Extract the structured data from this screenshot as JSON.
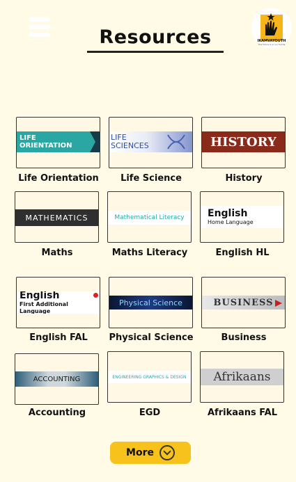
{
  "header": {
    "title": "Resources",
    "logo": {
      "name": "IKAMVAYOUTH",
      "tagline": "The future is in our hands"
    }
  },
  "resources": [
    {
      "label": "Life Orientation",
      "banner": "LIFE\nORIENTATION"
    },
    {
      "label": "Life Science",
      "banner": "LIFE\nSCIENCES"
    },
    {
      "label": "History",
      "banner": "HISTORY"
    },
    {
      "label": "Maths",
      "banner": "MATHEMATICS"
    },
    {
      "label": "Maths Literacy",
      "banner": "Mathematical Literacy"
    },
    {
      "label": "English HL",
      "banner": "English",
      "sub": "Home Language"
    },
    {
      "label": "English FAL",
      "banner": "English",
      "sub": "First Additional Language"
    },
    {
      "label": "Physical Science",
      "banner": "Physical Science"
    },
    {
      "label": "Business",
      "banner": "BUSINESS"
    },
    {
      "label": "Accounting",
      "banner": "ACCOUNTING"
    },
    {
      "label": "EGD",
      "banner": "ENGINEERING GRAPHICS & DESIGN"
    },
    {
      "label": "Afrikaans FAL",
      "banner": "Afrikaans"
    }
  ],
  "more_label": "More",
  "colors": {
    "background": "#fffbe6",
    "accent": "#f7c21b"
  },
  "icons": {
    "menu": "hamburger-menu-icon",
    "more": "chevron-down-circle-icon"
  }
}
